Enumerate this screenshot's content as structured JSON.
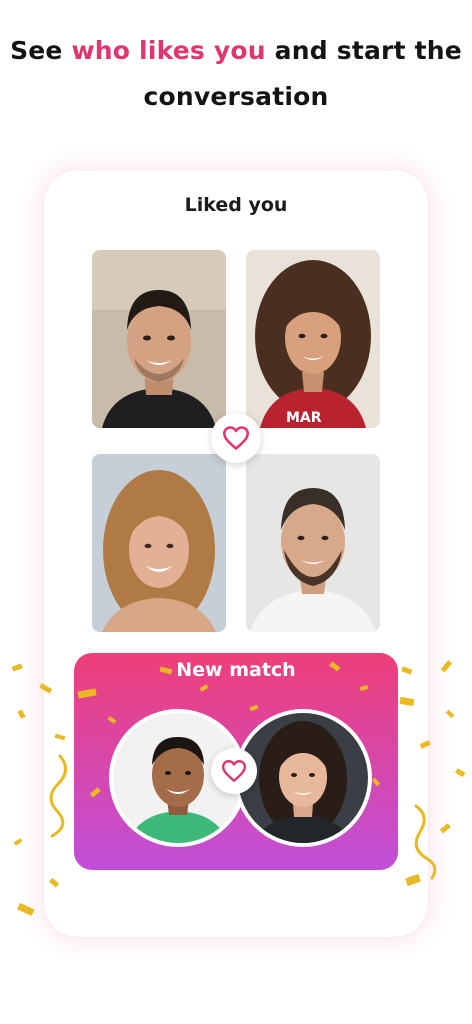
{
  "headline": {
    "part1": "See ",
    "highlight": "who likes you",
    "part2": " and start the conversation"
  },
  "liked_card": {
    "title": "Liked you",
    "photos": [
      {
        "name": "profile-photo-man-dark-hair"
      },
      {
        "name": "profile-photo-woman-curly-hair"
      },
      {
        "name": "profile-photo-woman-blonde"
      },
      {
        "name": "profile-photo-man-beard"
      }
    ]
  },
  "new_match": {
    "title": "New match"
  },
  "colors": {
    "accent": "#e0356f",
    "gradient_top": "#ee3f7a",
    "gradient_bottom": "#c04fd9",
    "confetti": "#e8b923"
  },
  "icons": [
    "heart-icon"
  ]
}
